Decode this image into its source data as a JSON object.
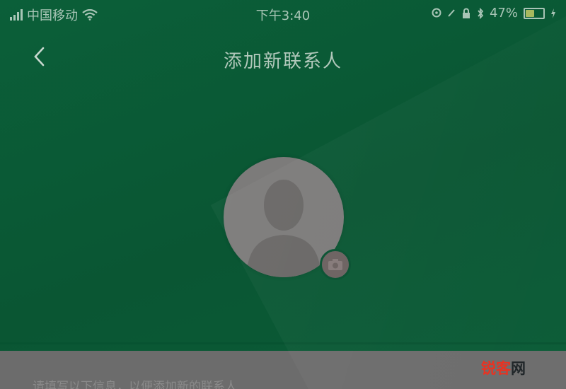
{
  "status_bar": {
    "carrier": "中国移动",
    "time": "下午3:40",
    "battery_percent": "47%",
    "battery_level": 0.47,
    "icons": [
      "signal-icon",
      "wifi-icon",
      "location-icon",
      "alarm-icon",
      "lock-icon",
      "bluetooth-icon",
      "battery-icon"
    ]
  },
  "nav": {
    "back_icon": "chevron-left-icon",
    "title": "添加新联系人"
  },
  "avatar": {
    "icon": "person-silhouette-icon",
    "badge_icon": "camera-icon"
  },
  "bottom": {
    "hint": "请填写以下信息，以便添加新的联系人"
  },
  "watermark": {
    "part1": "锐客",
    "part2": "网"
  },
  "colors": {
    "background": "#0a5a36",
    "avatar": "#7c7b7a",
    "bottom_panel": "#6c6c6c",
    "watermark_red": "#e8301f"
  }
}
